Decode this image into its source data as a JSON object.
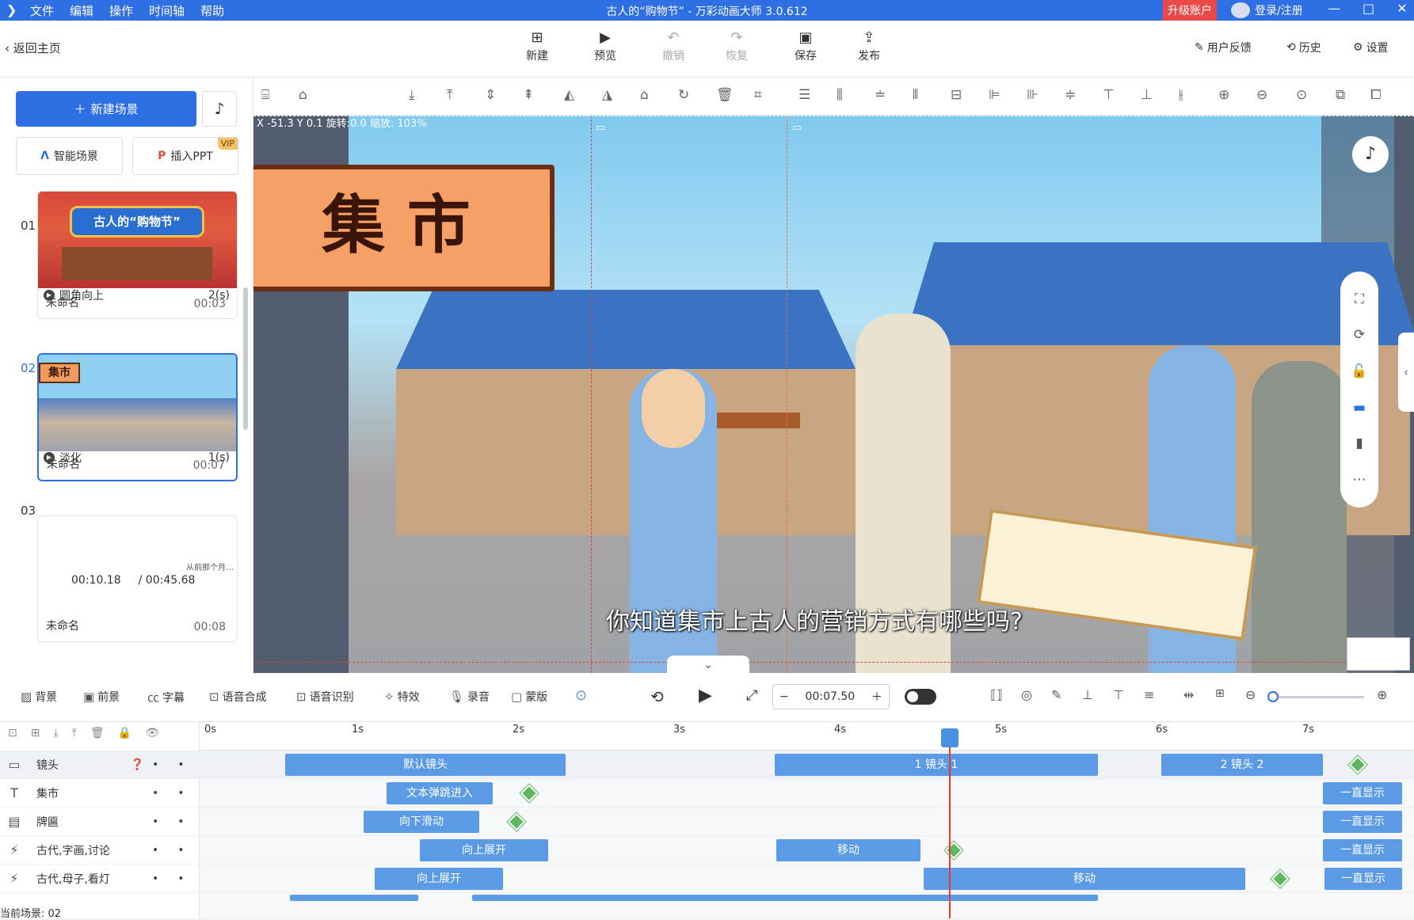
{
  "app": {
    "logo": "❯",
    "menus": [
      "文件",
      "编辑",
      "操作",
      "时间轴",
      "帮助"
    ],
    "title": "古人的“购物节” - 万彩动画大师 3.0.612",
    "upgrade": "升级账户",
    "login": "登录/注册",
    "window_controls": [
      "—",
      "□",
      "✕"
    ]
  },
  "toolbar": {
    "back": "返回主页",
    "new": "新建",
    "preview": "预览",
    "undo": "撤销",
    "redo": "恢复",
    "save": "保存",
    "publish": "发布",
    "feedback": "用户反馈",
    "history": "历史",
    "settings": "设置"
  },
  "left": {
    "new_scene": "新建场景",
    "smart_scene": "智能场景",
    "insert_ppt": "插入PPT",
    "vip": "VIP",
    "scenes": [
      {
        "num": "01",
        "name": "未命名",
        "duration": "00:03",
        "thumb_text": "古人的“购物节”",
        "transition": "圆角向上",
        "trans_time": "2(s)"
      },
      {
        "num": "02",
        "name": "未命名",
        "duration": "00:07",
        "thumb_text": "集市",
        "transition": "淡化",
        "trans_time": "1(s)"
      },
      {
        "num": "03",
        "name": "未命名",
        "duration": "00:08",
        "thumb_text": "从前那个月…"
      }
    ],
    "current_time": "00:10.18",
    "total_time": "/ 00:45.68"
  },
  "stage": {
    "coords": "X -51.3 Y 0.1 旋转:0.0 缩放: 103%",
    "sign": "集 市",
    "subtitle": "你知道集市上古人的营销方式有哪些吗?"
  },
  "timeline_toolbar": {
    "items": [
      "背景",
      "前景",
      "字幕",
      "语音合成",
      "语音识别",
      "特效",
      "录音",
      "蒙版"
    ],
    "time": "00:07.50"
  },
  "timeline": {
    "ticks": [
      "0s",
      "1s",
      "2s",
      "3s",
      "4s",
      "5s",
      "6s",
      "7s"
    ],
    "tracks": [
      {
        "icon": "▭",
        "name": "镜头"
      },
      {
        "icon": "T",
        "name": "集市"
      },
      {
        "icon": "▤",
        "name": "牌匾"
      },
      {
        "icon": "⚡",
        "name": "古代,字画,讨论"
      },
      {
        "icon": "⚡",
        "name": "古代,母子,看灯"
      }
    ],
    "clips": {
      "cam1": "默认镜头",
      "cam2": "1 镜头 1",
      "cam3": "2 镜头 2",
      "t1": "文本弹跳进入",
      "t1e": "一直显示",
      "t2": "向下滑动",
      "t2e": "一直显示",
      "t3a": "向上展开",
      "t3b": "移动",
      "t3e": "一直显示",
      "t4a": "向上展开",
      "t4b": "移动",
      "t4e": "一直显示"
    },
    "current_scene": "当前场景: 02"
  }
}
